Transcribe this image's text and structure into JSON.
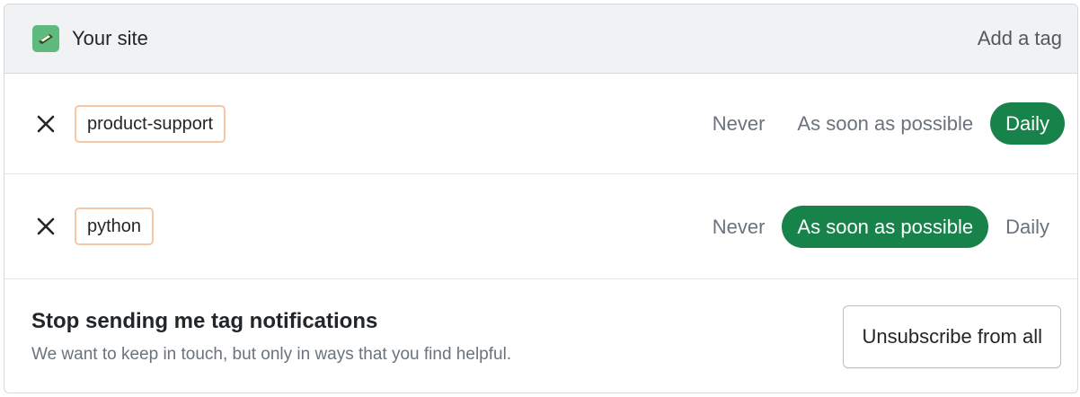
{
  "header": {
    "site_name": "Your site",
    "add_tag_label": "Add a tag",
    "site_icon": "site-logo-icon"
  },
  "tags": [
    {
      "name": "product-support",
      "options": [
        "Never",
        "As soon as possible",
        "Daily"
      ],
      "selected": "Daily"
    },
    {
      "name": "python",
      "options": [
        "Never",
        "As soon as possible",
        "Daily"
      ],
      "selected": "As soon as possible"
    }
  ],
  "footer": {
    "title": "Stop sending me tag notifications",
    "subtitle": "We want to keep in touch, but only in ways that you find helpful.",
    "unsubscribe_label": "Unsubscribe from all"
  },
  "colors": {
    "accent": "#17824a",
    "tag_border": "#f7c6a3",
    "header_bg": "#f1f2f3",
    "site_icon_bg": "#5eba7d"
  }
}
